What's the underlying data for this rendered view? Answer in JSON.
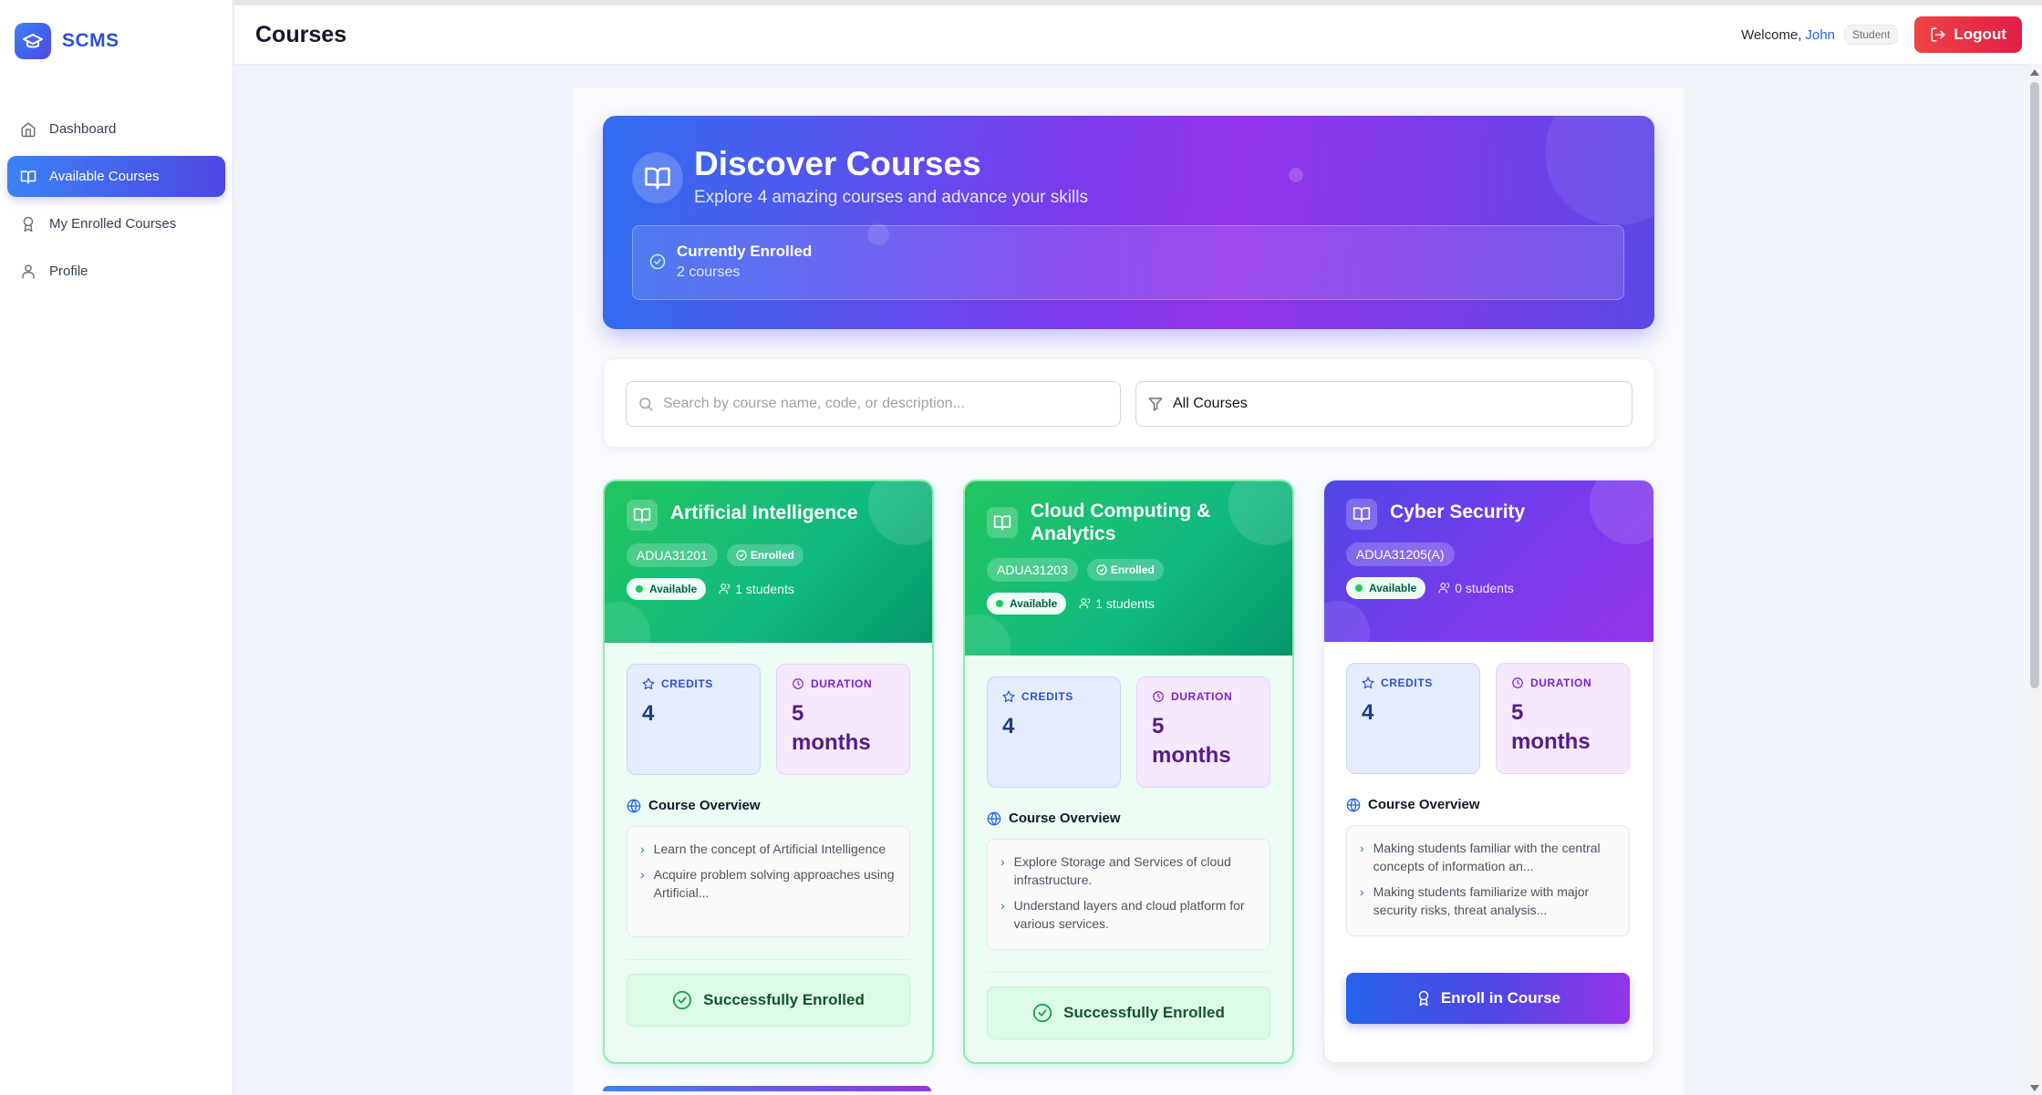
{
  "app": {
    "name": "SCMS"
  },
  "sidebar": {
    "items": [
      {
        "label": "Dashboard",
        "icon": "home-icon",
        "active": false
      },
      {
        "label": "Available Courses",
        "icon": "book-open-icon",
        "active": true
      },
      {
        "label": "My Enrolled Courses",
        "icon": "award-icon",
        "active": false
      },
      {
        "label": "Profile",
        "icon": "user-icon",
        "active": false
      }
    ]
  },
  "header": {
    "title": "Courses",
    "welcome": "Welcome,",
    "user_name": "John",
    "role": "Student",
    "logout_label": "Logout"
  },
  "hero": {
    "title": "Discover Courses",
    "subtitle": "Explore 4 amazing courses and advance your skills",
    "enrolled_label": "Currently Enrolled",
    "enrolled_count": "2 courses"
  },
  "filters": {
    "search_placeholder": "Search by course name, code, or description...",
    "category_value": "All Courses"
  },
  "courses": [
    {
      "title": "Artificial Intelligence",
      "code": "ADUA31201",
      "enrolled_badge": "Enrolled",
      "status": "Available",
      "students": "1 students",
      "credits_label": "CREDITS",
      "credits": "4",
      "duration_label": "DURATION",
      "duration_num": "5",
      "duration_unit": "months",
      "overview_label": "Course Overview",
      "overview": [
        "Learn the concept of Artificial Intelligence",
        "Acquire problem solving approaches using Artificial..."
      ],
      "action": "Successfully Enrolled"
    },
    {
      "title": "Cloud Computing & Analytics",
      "code": "ADUA31203",
      "enrolled_badge": "Enrolled",
      "status": "Available",
      "students": "1 students",
      "credits_label": "CREDITS",
      "credits": "4",
      "duration_label": "DURATION",
      "duration_num": "5",
      "duration_unit": "months",
      "overview_label": "Course Overview",
      "overview": [
        "Explore Storage and Services of cloud infrastructure.",
        "Understand layers and cloud platform for various services."
      ],
      "action": "Successfully Enrolled"
    },
    {
      "title": "Cyber Security",
      "code": "ADUA31205(A)",
      "status": "Available",
      "students": "0 students",
      "credits_label": "CREDITS",
      "credits": "4",
      "duration_label": "DURATION",
      "duration_num": "5",
      "duration_unit": "months",
      "overview_label": "Course Overview",
      "overview": [
        "Making students familiar with the central concepts of information an...",
        "Making students familiarize with major security risks, threat analysis..."
      ],
      "action": "Enroll in Course"
    }
  ],
  "colors": {
    "primary": "#4f46e5",
    "enrolled_green": "#10b981",
    "logout_red": "#e11d48",
    "accent_purple": "#9333ea"
  }
}
